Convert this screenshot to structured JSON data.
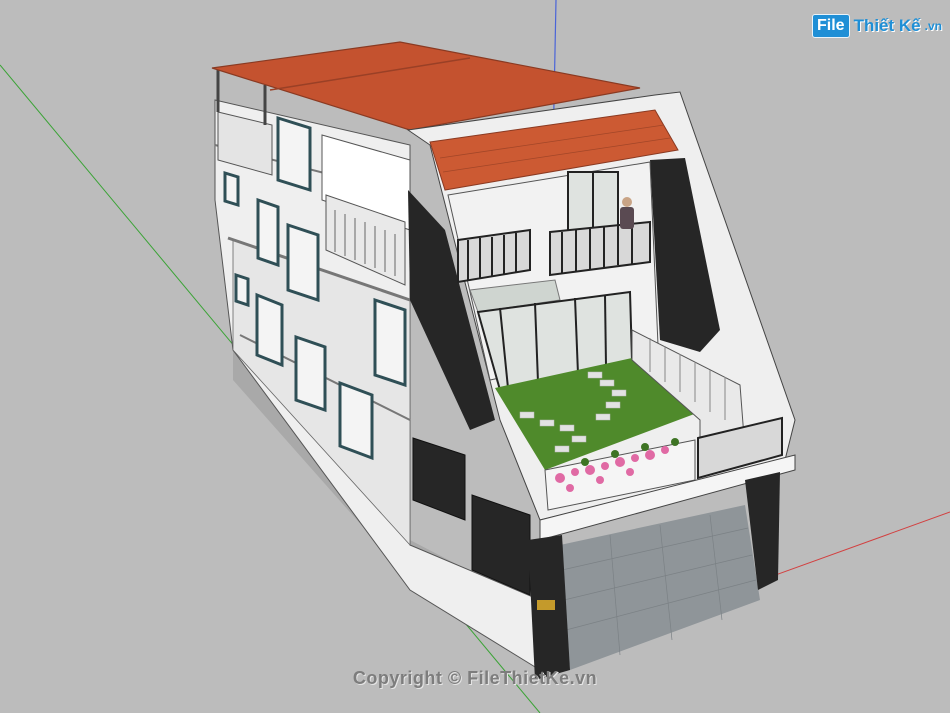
{
  "watermark": {
    "logo_badge": "File",
    "logo_text": "Thiết Kế",
    "logo_tld": ".vn",
    "copyright": "Copyright © FileThietKe.vn"
  },
  "colors": {
    "background": "#bcbcbc",
    "wall": "#efefef",
    "wall_shadow": "#d4d4d4",
    "roof_tile": "#c4522f",
    "roof_edge": "#8a3a22",
    "dark_panel": "#262626",
    "lawn": "#4f8a2b",
    "glass": "#dfe3e0",
    "floor": "#8f9599",
    "axis_green": "#3aa335",
    "axis_red": "#d24040",
    "axis_blue": "#4a64d8",
    "flowers": "#e06aa4",
    "logo_blue": "#1f8fd6"
  },
  "icons": [
    "sketchup-axis-lines",
    "person-figure",
    "flower-planter"
  ]
}
